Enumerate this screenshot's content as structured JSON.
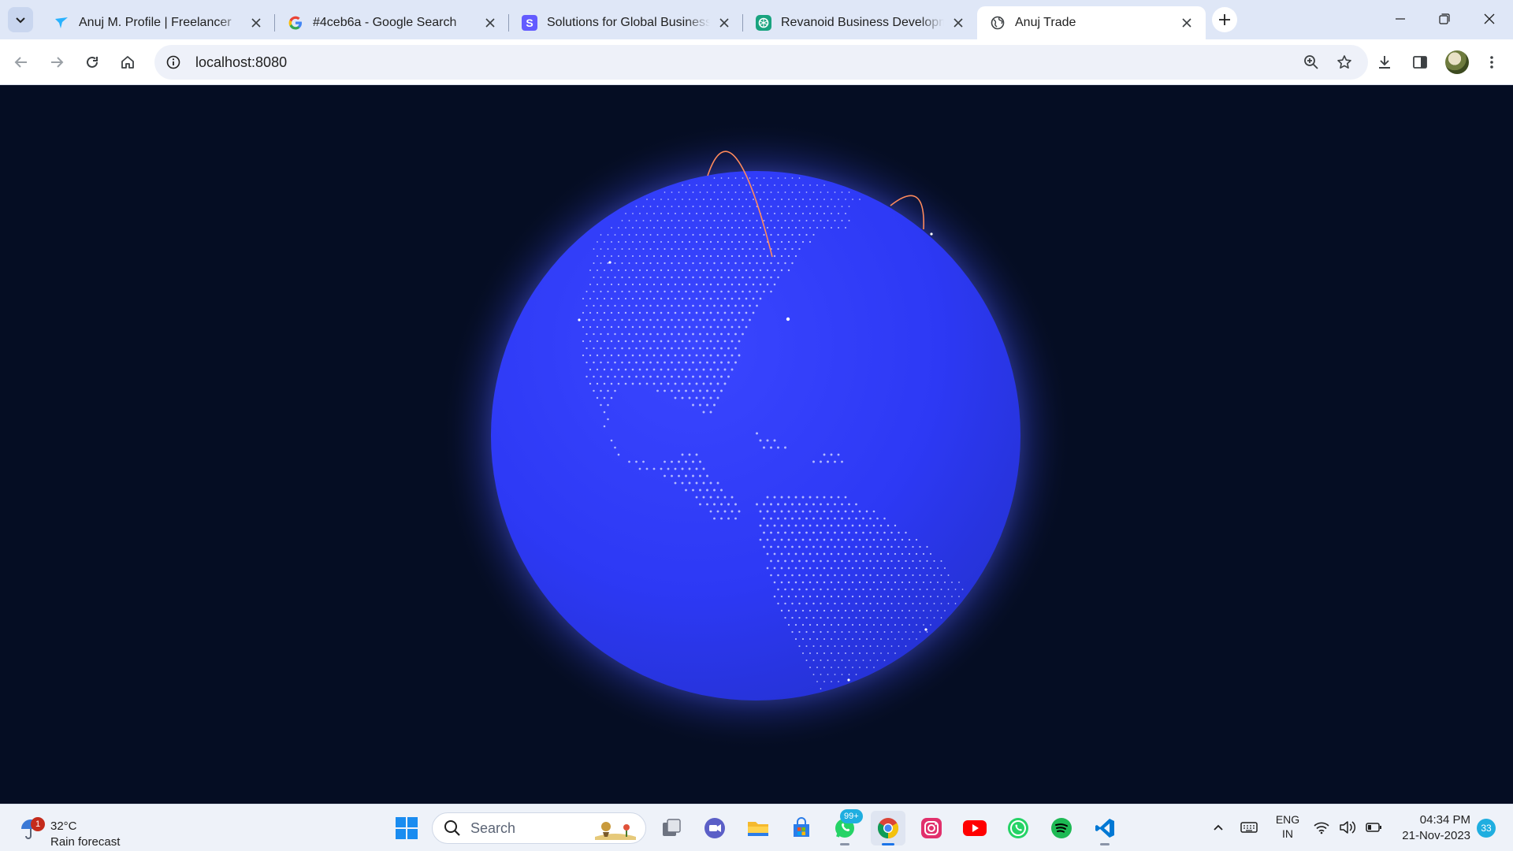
{
  "browser": {
    "tabs": [
      {
        "title": "Anuj M. Profile | Freelancer",
        "favicon": "freelancer-bird-icon",
        "active": false
      },
      {
        "title": "#4ceb6a - Google Search",
        "favicon": "google-g-icon",
        "active": false
      },
      {
        "title": "Solutions for Global Businesses",
        "favicon": "stripe-s-icon",
        "active": false
      },
      {
        "title": "Revanoid Business Development",
        "favicon": "chatgpt-icon",
        "active": false
      },
      {
        "title": "Anuj Trade",
        "favicon": "globe-icon",
        "active": true
      }
    ],
    "url": "localhost:8080"
  },
  "page": {
    "background_color": "#050d23",
    "globe_color": "#2f3df7",
    "arc_color": "#ff8a5c"
  },
  "taskbar": {
    "weather": {
      "temp": "32°C",
      "desc": "Rain forecast",
      "badge": "1"
    },
    "search_label": "Search",
    "apps": [
      "task-view-icon",
      "teams-meet-icon",
      "file-explorer-icon",
      "microsoft-store-icon",
      "whatsapp-icon",
      "chrome-icon",
      "instagram-icon",
      "youtube-icon",
      "whatsapp-icon",
      "spotify-icon",
      "vscode-icon"
    ],
    "whatsapp_badge": "99+",
    "lang_line1": "ENG",
    "lang_line2": "IN",
    "time": "04:34 PM",
    "date": "21-Nov-2023",
    "notifications": "33"
  }
}
